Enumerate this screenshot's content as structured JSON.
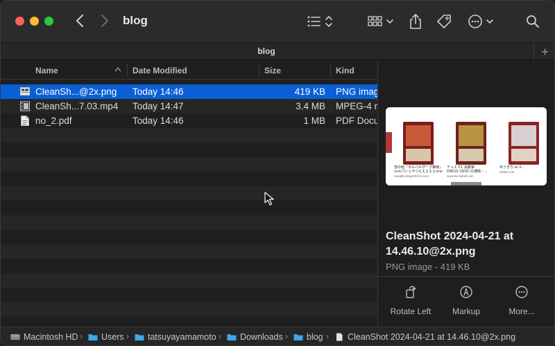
{
  "window": {
    "title": "blog"
  },
  "tabbar": {
    "tab_label": "blog",
    "add_label": "+"
  },
  "columns": {
    "name": "Name",
    "date": "Date Modified",
    "size": "Size",
    "kind": "Kind"
  },
  "files": [
    {
      "name": "CleanSh...@2x.png",
      "date": "Today 14:46",
      "size": "419 KB",
      "kind": "PNG imag",
      "icon": "png-file-icon",
      "selected": true
    },
    {
      "name": "CleanSh...7.03.mp4",
      "date": "Today 14:47",
      "size": "3.4 MB",
      "kind": "MPEG-4 m",
      "icon": "video-file-icon",
      "selected": false
    },
    {
      "name": "no_2.pdf",
      "date": "Today 14:46",
      "size": "1 MB",
      "kind": "PDF Docu",
      "icon": "pdf-file-icon",
      "selected": false
    }
  ],
  "preview": {
    "title": "CleanShot 2024-04-21 at 14.46.10@2x.png",
    "subtitle": "PNG image - 419 KB",
    "thumbnail_captions": [
      "苦の極「ボルバルザーク秦様」\nｗｗパシュラつえええええｗｗ",
      "デュエマ】黒龍掌\nDMC21-19/UC の通販・...",
      "ゆうきち on X..."
    ],
    "thumbnail_sources": [
      "sunattio.blog100.fc2.com",
      "www.ka-naball.com",
      "twitter.com"
    ],
    "actions": [
      {
        "label": "Rotate Left",
        "icon": "rotate-left-icon"
      },
      {
        "label": "Markup",
        "icon": "markup-icon"
      },
      {
        "label": "More...",
        "icon": "more-icon"
      }
    ]
  },
  "pathbar": {
    "items": [
      {
        "label": "Macintosh HD",
        "icon": "hard-drive-icon"
      },
      {
        "label": "Users",
        "icon": "folder-icon"
      },
      {
        "label": "tatsuyayamamoto",
        "icon": "folder-icon"
      },
      {
        "label": "Downloads",
        "icon": "folder-icon"
      },
      {
        "label": "blog",
        "icon": "folder-icon"
      },
      {
        "label": "CleanShot 2024-04-21 at 14.46.10@2x.png",
        "icon": "file-icon"
      }
    ]
  },
  "colors": {
    "selection": "#0a5fd6",
    "close": "#ff5f57",
    "minimize": "#febc2e",
    "maximize": "#28c840",
    "folder": "#3fa7ea"
  }
}
